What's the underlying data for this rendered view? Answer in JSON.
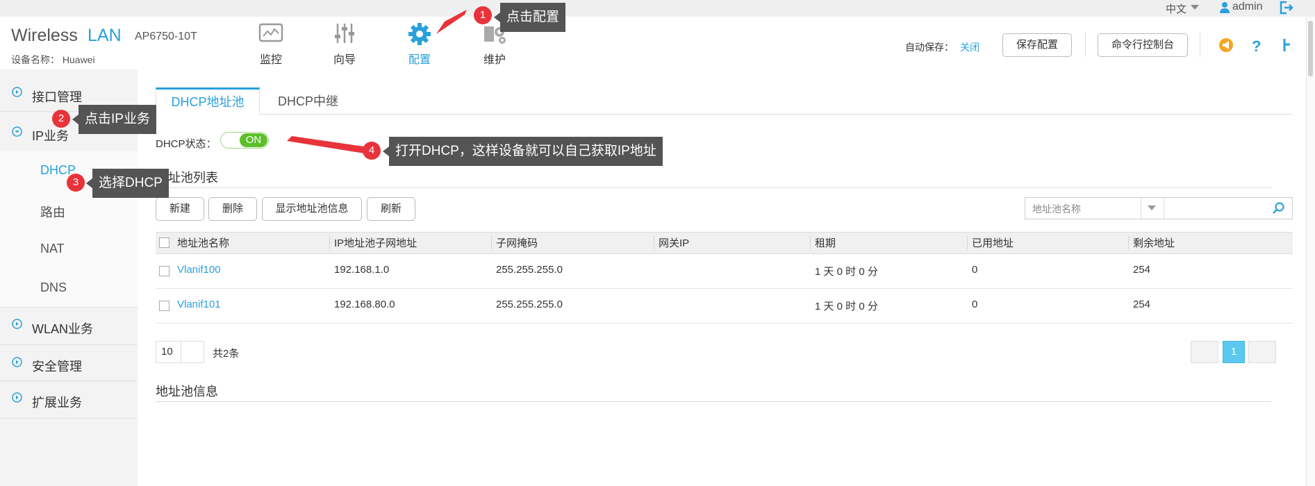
{
  "topbar": {
    "language": "中文",
    "user": "admin"
  },
  "brand": {
    "word1": "Wireless",
    "word2": "LAN",
    "model": "AP6750-10T",
    "device_name": "设备名称： Huawei"
  },
  "nav": [
    {
      "label": "监控",
      "icon": "monitor-icon"
    },
    {
      "label": "向导",
      "icon": "wizard-sliders-icon"
    },
    {
      "label": "配置",
      "icon": "gear-icon",
      "active": true
    },
    {
      "label": "维护",
      "icon": "maintenance-gears-icon"
    }
  ],
  "header_right": {
    "autosave_label": "自动保存：",
    "autosave_value": "关闭",
    "save_config": "保存配置",
    "cli_console": "命令行控制台"
  },
  "sidebar": {
    "items": [
      {
        "label": "接口管理"
      },
      {
        "label": "IP业务",
        "expanded": true
      },
      {
        "label": "WLAN业务"
      },
      {
        "label": "安全管理"
      },
      {
        "label": "扩展业务"
      }
    ],
    "sub_items": [
      {
        "label": "DHCP",
        "active": true
      },
      {
        "label": "路由"
      },
      {
        "label": "NAT"
      },
      {
        "label": "DNS"
      }
    ]
  },
  "tabs": [
    {
      "label": "DHCP地址池",
      "active": true
    },
    {
      "label": "DHCP中继"
    }
  ],
  "dhcp_status": {
    "label": "DHCP状态：",
    "value": "ON"
  },
  "pool_list": {
    "title": "地址池列表",
    "buttons": {
      "new": "新建",
      "delete": "删除",
      "show_info": "显示地址池信息",
      "refresh": "刷新"
    },
    "search_field": "地址池名称",
    "columns": [
      "地址池名称",
      "IP地址池子网地址",
      "子网掩码",
      "网关IP",
      "租期",
      "已用地址",
      "剩余地址"
    ],
    "rows": [
      {
        "name": "Vlanif100",
        "subnet": "192.168.1.0",
        "mask": "255.255.255.0",
        "gateway": "",
        "lease": "1 天 0 时 0 分",
        "used": "0",
        "remaining": "254"
      },
      {
        "name": "Vlanif101",
        "subnet": "192.168.80.0",
        "mask": "255.255.255.0",
        "gateway": "",
        "lease": "1 天 0 时 0 分",
        "used": "0",
        "remaining": "254"
      }
    ],
    "page_size": "10",
    "total": "共2条",
    "current_page": "1"
  },
  "pool_info": {
    "title": "地址池信息"
  },
  "annotations": [
    {
      "num": "1",
      "text": "点击配置"
    },
    {
      "num": "2",
      "text": "点击IP业务"
    },
    {
      "num": "3",
      "text": "选择DHCP"
    },
    {
      "num": "4",
      "text": "打开DHCP，这样设备就可以自己获取IP地址"
    }
  ],
  "colors": {
    "accent": "#29a0dc",
    "toggle_on": "#5cbf2a",
    "annotation_red": "#e8333a",
    "callout_bg": "#545454"
  }
}
